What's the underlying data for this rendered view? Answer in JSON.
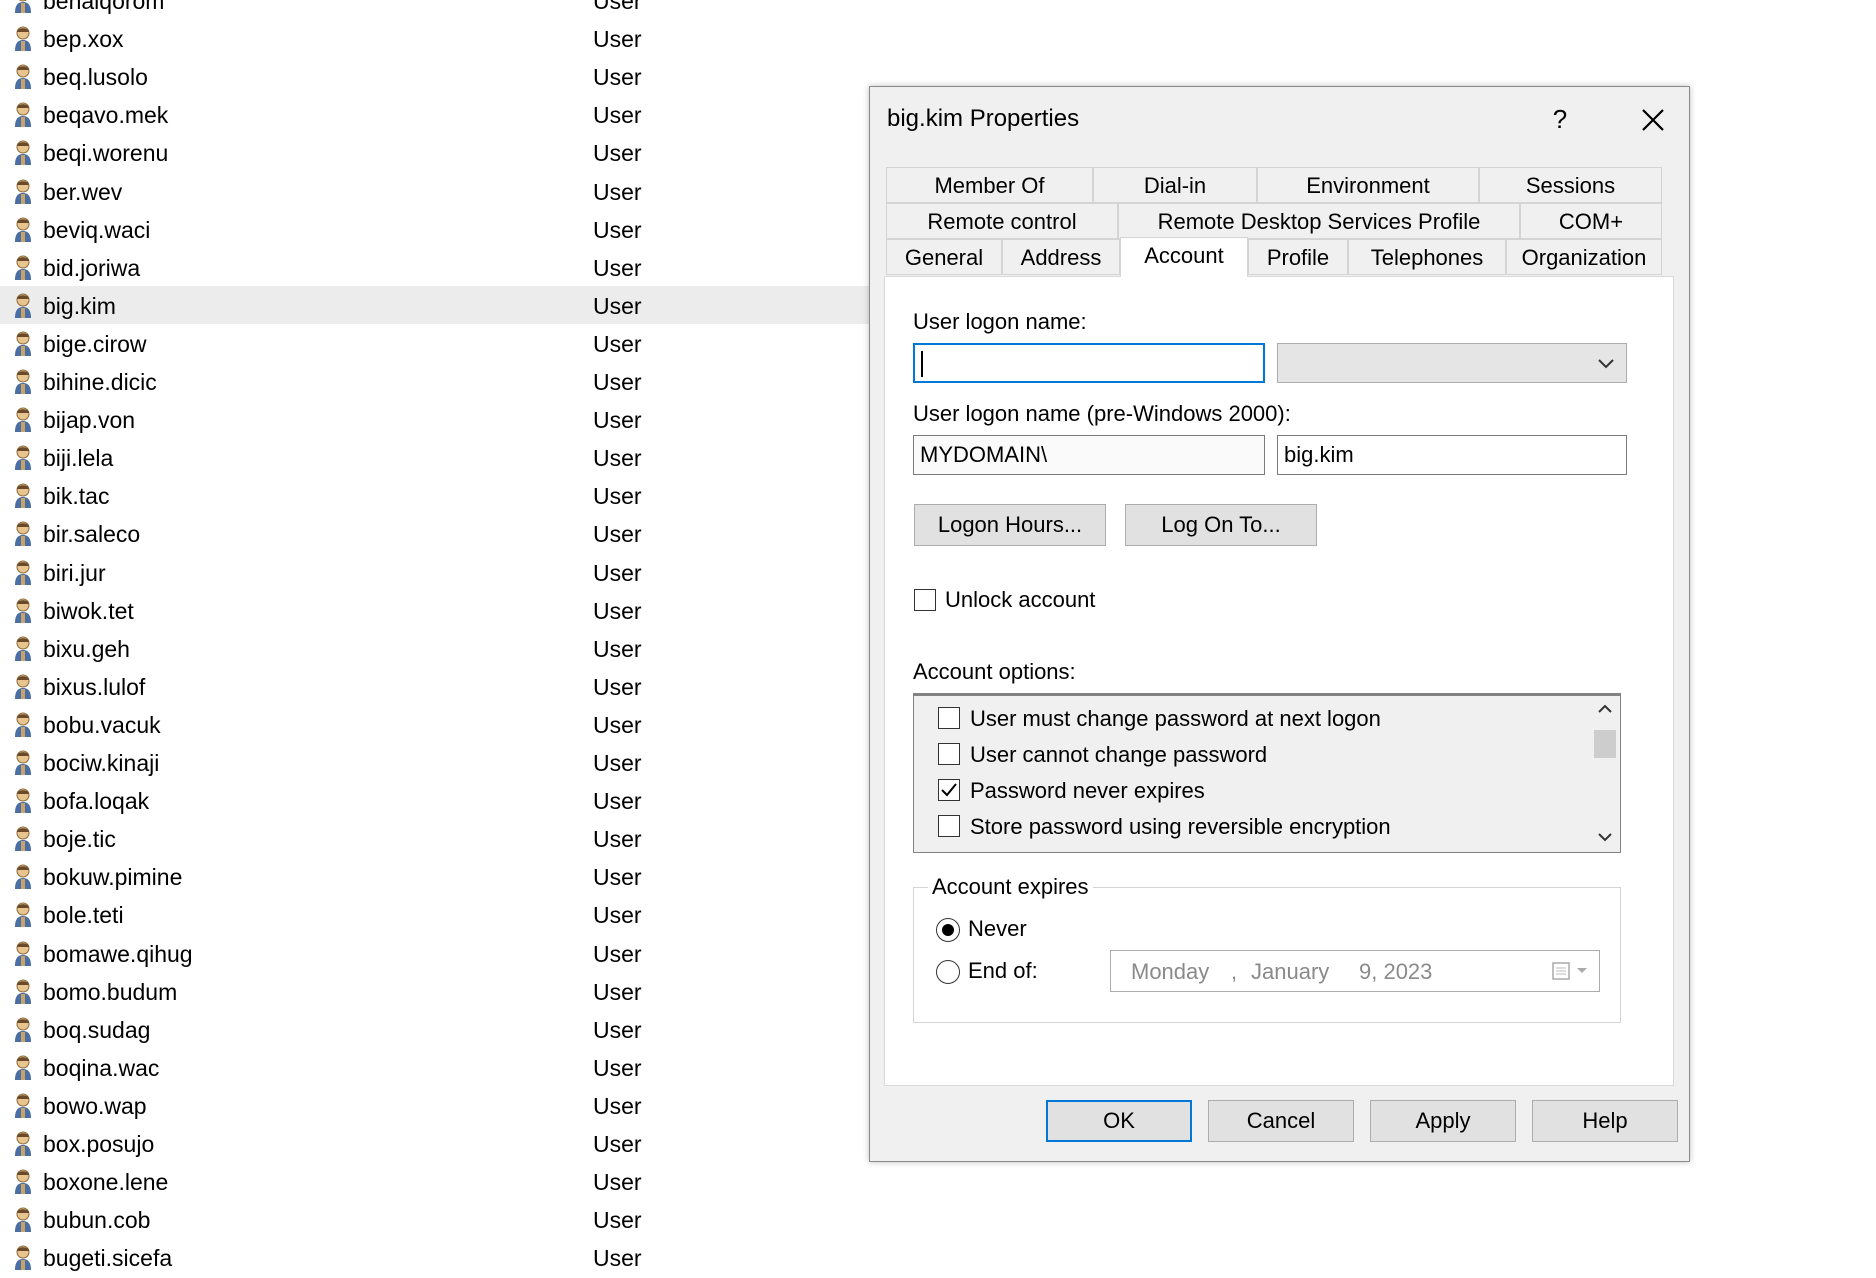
{
  "users": [
    {
      "name": "benalqorom",
      "type": "User"
    },
    {
      "name": "bep.xox",
      "type": "User"
    },
    {
      "name": "beq.lusolo",
      "type": "User"
    },
    {
      "name": "beqavo.mek",
      "type": "User"
    },
    {
      "name": "beqi.worenu",
      "type": "User"
    },
    {
      "name": "ber.wev",
      "type": "User"
    },
    {
      "name": "beviq.waci",
      "type": "User"
    },
    {
      "name": "bid.joriwa",
      "type": "User"
    },
    {
      "name": "big.kim",
      "type": "User",
      "selected": true
    },
    {
      "name": "bige.cirow",
      "type": "User"
    },
    {
      "name": "bihine.dicic",
      "type": "User"
    },
    {
      "name": "bijap.von",
      "type": "User"
    },
    {
      "name": "biji.lela",
      "type": "User"
    },
    {
      "name": "bik.tac",
      "type": "User"
    },
    {
      "name": "bir.saleco",
      "type": "User"
    },
    {
      "name": "biri.jur",
      "type": "User"
    },
    {
      "name": "biwok.tet",
      "type": "User"
    },
    {
      "name": "bixu.geh",
      "type": "User"
    },
    {
      "name": "bixus.lulof",
      "type": "User"
    },
    {
      "name": "bobu.vacuk",
      "type": "User"
    },
    {
      "name": "bociw.kinaji",
      "type": "User"
    },
    {
      "name": "bofa.loqak",
      "type": "User"
    },
    {
      "name": "boje.tic",
      "type": "User"
    },
    {
      "name": "bokuw.pimine",
      "type": "User"
    },
    {
      "name": "bole.teti",
      "type": "User"
    },
    {
      "name": "bomawe.qihug",
      "type": "User"
    },
    {
      "name": "bomo.budum",
      "type": "User"
    },
    {
      "name": "boq.sudag",
      "type": "User"
    },
    {
      "name": "boqina.wac",
      "type": "User"
    },
    {
      "name": "bowo.wap",
      "type": "User"
    },
    {
      "name": "box.posujo",
      "type": "User"
    },
    {
      "name": "boxone.lene",
      "type": "User"
    },
    {
      "name": "bubun.cob",
      "type": "User"
    },
    {
      "name": "bugeti.sicefa",
      "type": "User"
    }
  ],
  "user_icon": "user-icon",
  "dialog": {
    "title": "big.kim Properties",
    "help_label": "?",
    "tabs": {
      "member_of": "Member Of",
      "dial_in": "Dial-in",
      "environment": "Environment",
      "sessions": "Sessions",
      "remote_control": "Remote control",
      "rds_profile": "Remote Desktop Services Profile",
      "com_plus": "COM+",
      "general": "General",
      "address": "Address",
      "account": "Account",
      "profile": "Profile",
      "telephones": "Telephones",
      "organization": "Organization"
    },
    "active_tab": "Account",
    "account": {
      "logon_name_label": "User logon name:",
      "logon_name_value": "",
      "pre2000_label": "User logon name (pre-Windows 2000):",
      "domain_value": "MYDOMAIN\\",
      "pre2000_value": "big.kim",
      "logon_hours_label": "Logon Hours...",
      "log_on_to_label": "Log On To...",
      "unlock_label": "Unlock account",
      "options_label": "Account options:",
      "options": [
        {
          "label": "User must change password at next logon",
          "checked": false
        },
        {
          "label": "User cannot change password",
          "checked": false
        },
        {
          "label": "Password never expires",
          "checked": true
        },
        {
          "label": "Store password using reversible encryption",
          "checked": false
        }
      ],
      "expires_label": "Account expires",
      "never_label": "Never",
      "end_of_label": "End of:",
      "selected_expiry": "Never",
      "date": {
        "weekday": "Monday",
        "sep": ",",
        "month": "January",
        "day_year": "9, 2023"
      }
    },
    "buttons": {
      "ok": "OK",
      "cancel": "Cancel",
      "apply": "Apply",
      "help": "Help"
    }
  },
  "colors": {
    "accent": "#0078d7",
    "selected_row": "#ececec",
    "dialog_bg": "#f0f0f0"
  }
}
